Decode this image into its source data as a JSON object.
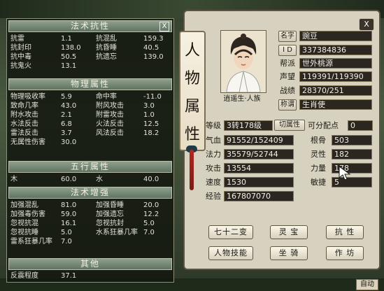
{
  "left_panel": {
    "sections": {
      "magic_resist": {
        "title": "法术抗性",
        "close_label": "X",
        "rows": [
          [
            "抗雷",
            "1.1",
            "抗混乱",
            "159.3"
          ],
          [
            "抗封印",
            "138.0",
            "抗昏睡",
            "40.5"
          ],
          [
            "抗中毒",
            "50.5",
            "抗遗忘",
            "139.0"
          ],
          [
            "抗鬼火",
            "13.1",
            "",
            ""
          ]
        ]
      },
      "physical": {
        "title": "物理属性",
        "rows": [
          [
            "物理吸收率",
            "5.9",
            "命中率",
            "-11.0"
          ],
          [
            "致命几率",
            "43.0",
            "附风攻击",
            "3.0"
          ],
          [
            "附水攻击",
            "2.1",
            "附雷攻击",
            "1.0"
          ],
          [
            "水法反击",
            "6.8",
            "火法反击",
            "12.5"
          ],
          [
            "雷法反击",
            "3.7",
            "风法反击",
            "18.2"
          ],
          [
            "无属性伤害",
            "30.0",
            "",
            ""
          ]
        ]
      },
      "five_elements": {
        "title": "五行属性",
        "rows": [
          [
            "木",
            "60.0",
            "水",
            "40.0"
          ]
        ]
      },
      "magic_boost": {
        "title": "法术增强",
        "rows": [
          [
            "加强混乱",
            "81.0",
            "加强昏睡",
            "20.0"
          ],
          [
            "加强毒伤害",
            "59.0",
            "加强遗忘",
            "12.2"
          ],
          [
            "忽视抗混",
            "16.1",
            "忽视抗封",
            "5.0"
          ],
          [
            "忽视抗睡",
            "5.0",
            "水系狂暴几率",
            "7.0"
          ],
          [
            "雷系狂暴几率",
            "7.0",
            "",
            ""
          ]
        ]
      },
      "other": {
        "title": "其他",
        "rows": [
          [
            "反震程度",
            "37.1",
            "",
            ""
          ]
        ]
      }
    }
  },
  "right_panel": {
    "scroll_title": [
      "人",
      "物",
      "属",
      "性"
    ],
    "close_label": "X",
    "portrait_caption": "逍遥生·人族",
    "name_label": "名字",
    "name_value": "豌豆",
    "id_label": "I D",
    "id_value": "337384836",
    "faction_label": "帮派",
    "faction_value": "世外桃源",
    "prestige_label": "声望",
    "prestige_value": "119391/119390",
    "record_label": "战绩",
    "record_value": "28370/251",
    "title_label": "称谓",
    "title_value": "生肖使",
    "level_label": "等级",
    "level_value": "3转178级",
    "switch_label": "切属性",
    "points_label": "可分配点",
    "points_value": "0",
    "hp_label": "气血",
    "hp_value": "91552/152409",
    "bone_label": "根骨",
    "bone_value": "503",
    "mp_label": "法力",
    "mp_value": "35579/52744",
    "spirit_label": "灵性",
    "spirit_value": "182",
    "atk_label": "攻击",
    "atk_value": "13554",
    "str_label": "力量",
    "str_value": "178",
    "spd_label": "速度",
    "spd_value": "1530",
    "agi_label": "敏捷",
    "agi_value": "5",
    "exp_label": "经验",
    "exp_value": "167807070",
    "buttons": {
      "seventy_two": "七十二变",
      "treasure": "灵 宝",
      "resist": "抗 性",
      "persona": "人物技能",
      "mount": "坐 骑",
      "craft": "作 坊"
    }
  },
  "footer": {
    "auto_label": "自动"
  },
  "colors": {
    "left_bg": "#141810",
    "section_header": "#6f836f",
    "right_bg": "#d7d2bf",
    "value_box": "#2b2620"
  }
}
